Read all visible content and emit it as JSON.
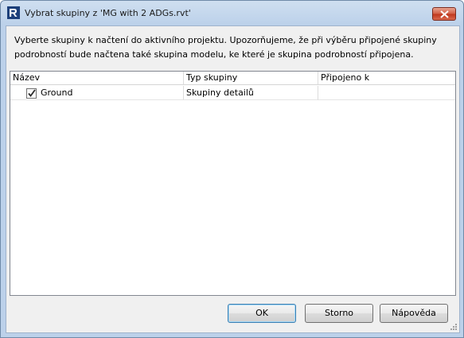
{
  "window": {
    "title": "Vybrat skupiny z 'MG with 2 ADGs.rvt'",
    "app_icon": "revit-logo-icon",
    "close_icon": "close-icon"
  },
  "instruction": "Vyberte skupiny k načtení do aktivního projektu. Upozorňujeme, že při výběru připojené skupiny podrobností bude načtena také skupina modelu, ke které je skupina podrobností připojena.",
  "table": {
    "columns": [
      "Název",
      "Typ skupiny",
      "Připojeno k"
    ],
    "rows": [
      {
        "checked": true,
        "name": "Ground",
        "type": "Skupiny detailů",
        "attached_to": ""
      }
    ]
  },
  "buttons": {
    "ok": "OK",
    "cancel": "Storno",
    "help": "Nápověda"
  },
  "colors": {
    "titlebar": "#bcd1ea",
    "close": "#c0391f",
    "default_button_border": "#3c7fb1"
  }
}
